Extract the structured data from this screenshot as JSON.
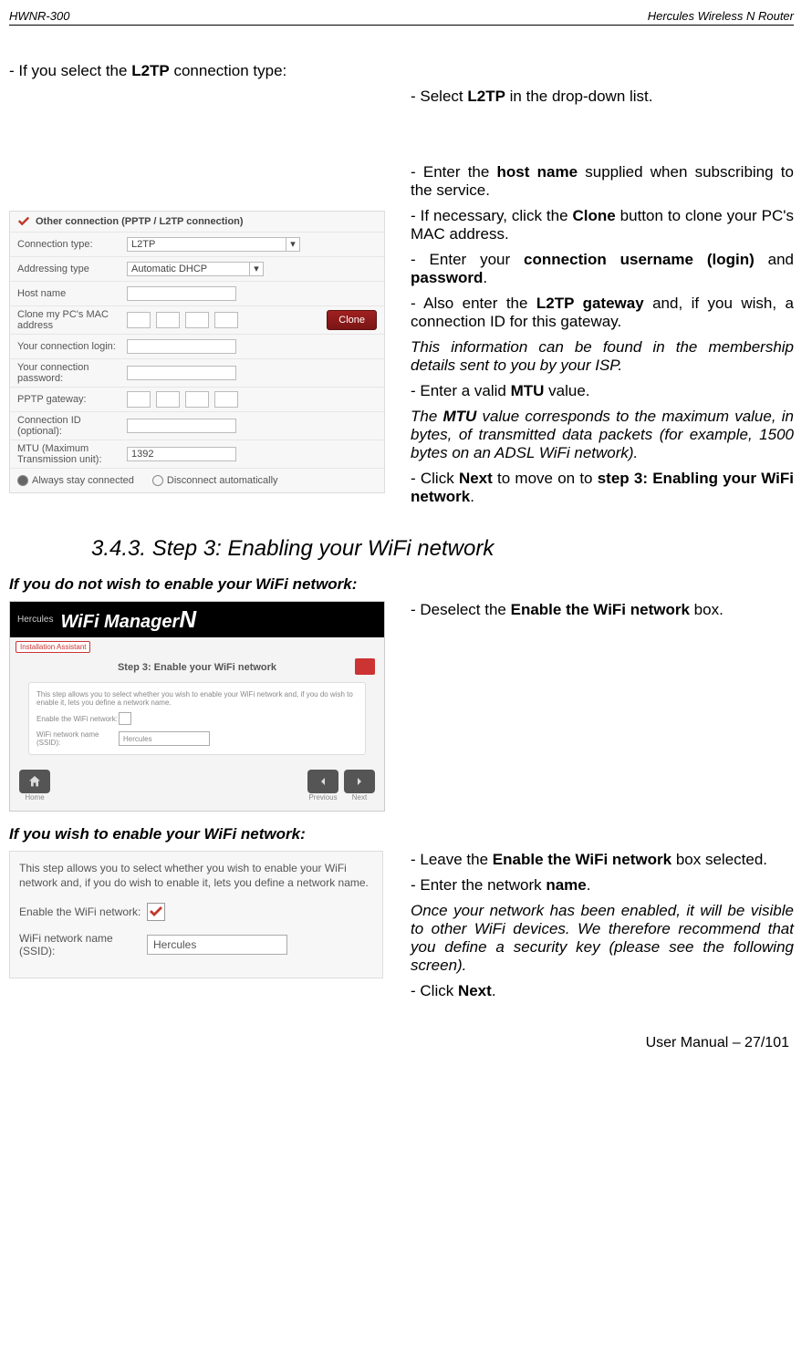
{
  "header": {
    "left": "HWNR-300",
    "right": "Hercules Wireless N Router"
  },
  "intro": {
    "prefix": "- If you select the ",
    "bold": "L2TP",
    "suffix": " connection type:"
  },
  "form": {
    "title": "Other connection (PPTP / L2TP connection)",
    "rows": {
      "conn_type_label": "Connection type:",
      "conn_type_value": "L2TP",
      "addr_type_label": "Addressing type",
      "addr_type_value": "Automatic DHCP",
      "host_label": "Host name",
      "mac_label": "Clone my PC's MAC address",
      "clone_btn": "Clone",
      "login_label": "Your connection login:",
      "pwd_label": "Your connection password:",
      "gateway_label": "PPTP gateway:",
      "connid_label": "Connection ID (optional):",
      "mtu_label": "MTU (Maximum Transmission unit):",
      "mtu_value": "1392",
      "radio1": "Always stay connected",
      "radio2": "Disconnect automatically"
    }
  },
  "right1": {
    "p1a": "- Select ",
    "p1b": "L2TP",
    "p1c": " in the drop-down list.",
    "p2a": "- Enter the ",
    "p2b": "host name",
    "p2c": " supplied when subscribing to the service.",
    "p3a": "- If necessary, click the ",
    "p3b": "Clone",
    "p3c": " button to clone your PC's MAC address.",
    "p4a": "- Enter your ",
    "p4b": "connection username (login)",
    "p4c": " and ",
    "p4d": "password",
    "p4e": ".",
    "p5a": "- Also enter the ",
    "p5b": "L2TP gateway",
    "p5c": " and, if you wish, a connection ID for this gateway.",
    "p6": "This information can be found in the membership details sent to you by your ISP.",
    "p7a": "- Enter a valid ",
    "p7b": "MTU",
    "p7c": " value.",
    "p8a": "The ",
    "p8b": "MTU",
    "p8c": " value corresponds to the maximum value, in bytes, of transmitted data packets (for example, 1500 bytes on an ADSL WiFi network).",
    "p9a": "- Click ",
    "p9b": "Next",
    "p9c": " to move on to ",
    "p9d": "step 3: Enabling your WiFi network",
    "p9e": "."
  },
  "heading343": "3.4.3. Step 3: Enabling your WiFi network",
  "sub1": "If you do not wish to enable your WiFi network:",
  "wifi_panel": {
    "brand": "Hercules",
    "title": "WiFi Manager",
    "badge": "Installation Assistant",
    "step": "Step 3: Enable your WiFi network",
    "desc": "This step allows you to select whether you wish to enable your WiFi network and, if you do wish to enable it, lets you define a network name.",
    "row1": "Enable the WiFi network:",
    "row2": "WiFi network name (SSID):",
    "ssid": "Hercules",
    "home": "Home",
    "prev": "Previous",
    "next": "Next"
  },
  "right2": {
    "p1a": "- Deselect the ",
    "p1b": "Enable the WiFi network",
    "p1c": " box."
  },
  "sub2": "If you wish to enable your WiFi network:",
  "enable_panel": {
    "desc": "This step allows you to select whether you wish to enable your WiFi network and, if you do wish to enable it, lets you define a network name.",
    "row1": "Enable the WiFi network:",
    "row2": "WiFi network name (SSID):",
    "ssid": "Hercules"
  },
  "right3": {
    "p1a": "- Leave the ",
    "p1b": "Enable the WiFi network",
    "p1c": " box selected.",
    "p2a": "- Enter the network ",
    "p2b": "name",
    "p2c": ".",
    "p3": "Once your network has been enabled, it will be visible to other WiFi devices.  We therefore recommend that you define a security key  (please see the following screen).",
    "p4a": "- Click ",
    "p4b": "Next",
    "p4c": "."
  },
  "footer": "User Manual – 27/101"
}
